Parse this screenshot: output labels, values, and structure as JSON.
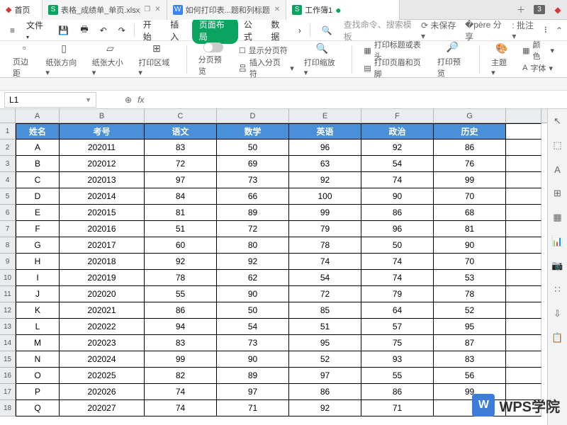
{
  "tabs": {
    "home": "首页",
    "file1": "表格_成绩单_单页.xlsx",
    "file2": "如何打印表...题和列标题",
    "file3": "工作簿1",
    "count": "3"
  },
  "menu": {
    "hamburger": "≡",
    "file": "文件",
    "start": "开始",
    "insert": "插入",
    "page_layout": "页面布局",
    "formula": "公式",
    "data": "数据",
    "more": "›",
    "search_placeholder": "查找命令、搜索模板",
    "unsaved": "未保存",
    "share": "分享",
    "batch": "批注"
  },
  "ribbon": {
    "margin": "页边距",
    "orientation": "纸张方向",
    "size": "纸张大小",
    "print_area": "打印区域",
    "page_break_preview": "分页预览",
    "show_page_break": "显示分页符",
    "insert_page_break": "插入分页符",
    "print_scale": "打印缩放",
    "print_titles": "打印标题或表头",
    "header_footer": "打印页眉和页脚",
    "print_preview": "打印预览",
    "theme": "主题",
    "color": "颜色",
    "font": "字体"
  },
  "namebox": "L1",
  "fx_label": "fx",
  "columns": [
    "A",
    "B",
    "C",
    "D",
    "E",
    "F",
    "G"
  ],
  "col_classes": [
    "cw-A",
    "cw-B",
    "cw-C",
    "cw-D",
    "cw-E",
    "cw-F",
    "cw-G"
  ],
  "header_row": [
    "姓名",
    "考号",
    "语文",
    "数学",
    "英语",
    "政治",
    "历史"
  ],
  "rows": [
    [
      "A",
      "202011",
      "83",
      "50",
      "96",
      "92",
      "86"
    ],
    [
      "B",
      "202012",
      "72",
      "69",
      "63",
      "54",
      "76"
    ],
    [
      "C",
      "202013",
      "97",
      "73",
      "92",
      "74",
      "99"
    ],
    [
      "D",
      "202014",
      "84",
      "66",
      "100",
      "90",
      "70"
    ],
    [
      "E",
      "202015",
      "81",
      "89",
      "99",
      "86",
      "68"
    ],
    [
      "F",
      "202016",
      "51",
      "72",
      "79",
      "96",
      "81"
    ],
    [
      "G",
      "202017",
      "60",
      "80",
      "78",
      "50",
      "90"
    ],
    [
      "H",
      "202018",
      "92",
      "92",
      "74",
      "74",
      "70"
    ],
    [
      "I",
      "202019",
      "78",
      "62",
      "54",
      "74",
      "53"
    ],
    [
      "J",
      "202020",
      "55",
      "90",
      "72",
      "79",
      "78"
    ],
    [
      "K",
      "202021",
      "86",
      "50",
      "85",
      "64",
      "52"
    ],
    [
      "L",
      "202022",
      "94",
      "54",
      "51",
      "57",
      "95"
    ],
    [
      "M",
      "202023",
      "83",
      "73",
      "95",
      "75",
      "87"
    ],
    [
      "N",
      "202024",
      "99",
      "90",
      "52",
      "93",
      "83"
    ],
    [
      "O",
      "202025",
      "82",
      "89",
      "97",
      "55",
      "56"
    ],
    [
      "P",
      "202026",
      "74",
      "97",
      "86",
      "86",
      "99"
    ],
    [
      "Q",
      "202027",
      "74",
      "71",
      "92",
      "71",
      ""
    ]
  ],
  "watermark": "WPS学院"
}
